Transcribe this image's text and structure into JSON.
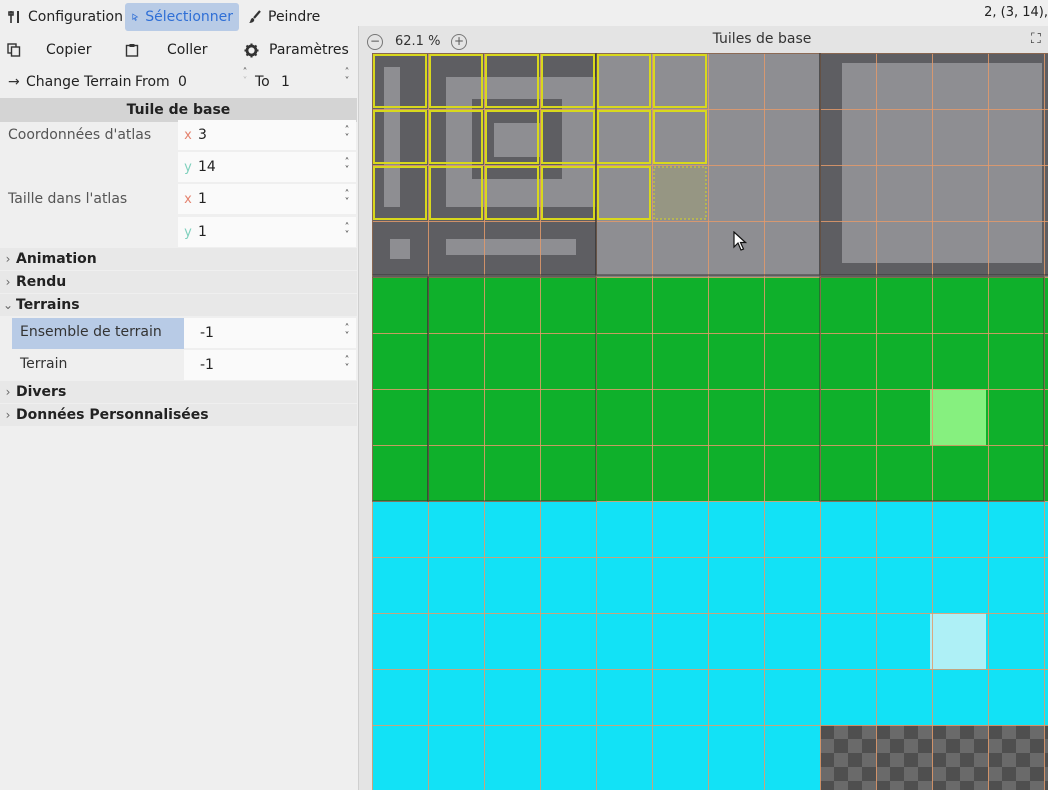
{
  "toolbar": {
    "tabs": [
      {
        "label": "Configuration",
        "icon": "wrench-screwdriver-icon"
      },
      {
        "label": "Sélectionner",
        "icon": "cursor-icon",
        "active": true
      },
      {
        "label": "Peindre",
        "icon": "brush-icon"
      }
    ],
    "coord_readout": "2, (3, 14),"
  },
  "inspector": {
    "copy_label": "Copier",
    "paste_label": "Coller",
    "settings_label": "Paramètres",
    "change_terrain": {
      "label": "Change Terrain",
      "from_label": "From",
      "from_value": "0",
      "to_label": "To",
      "to_value": "1"
    },
    "section_title": "Tuile de base",
    "atlas_coords": {
      "label": "Coordonnées d'atlas",
      "x_axis": "x",
      "x": "3",
      "y_axis": "y",
      "y": "14"
    },
    "atlas_size": {
      "label": "Taille dans l'atlas",
      "x_axis": "x",
      "x": "1",
      "y_axis": "y",
      "y": "1"
    },
    "groups": {
      "animation": "Animation",
      "rendu": "Rendu",
      "terrains": "Terrains",
      "divers": "Divers",
      "donnees": "Données Personnalisées"
    },
    "terrains": {
      "terrain_set_label": "Ensemble de terrain",
      "terrain_set_value": "-1",
      "terrain_label": "Terrain",
      "terrain_value": "-1"
    }
  },
  "atlas": {
    "zoom": "62.1 %",
    "title": "Tuiles de base",
    "colors": {
      "stone_dark": "#5e5e62",
      "stone_light": "#8e8e92",
      "grass": "#0fb02b",
      "grass_highlight": "#86f07f",
      "water": "#12e2f6",
      "water_highlight": "#aef0f6",
      "grid_line": "#e39a6b",
      "selection": "#d8d81c",
      "checker_dark": "#4f4f4f",
      "checker_light": "#6a6a6a"
    }
  }
}
